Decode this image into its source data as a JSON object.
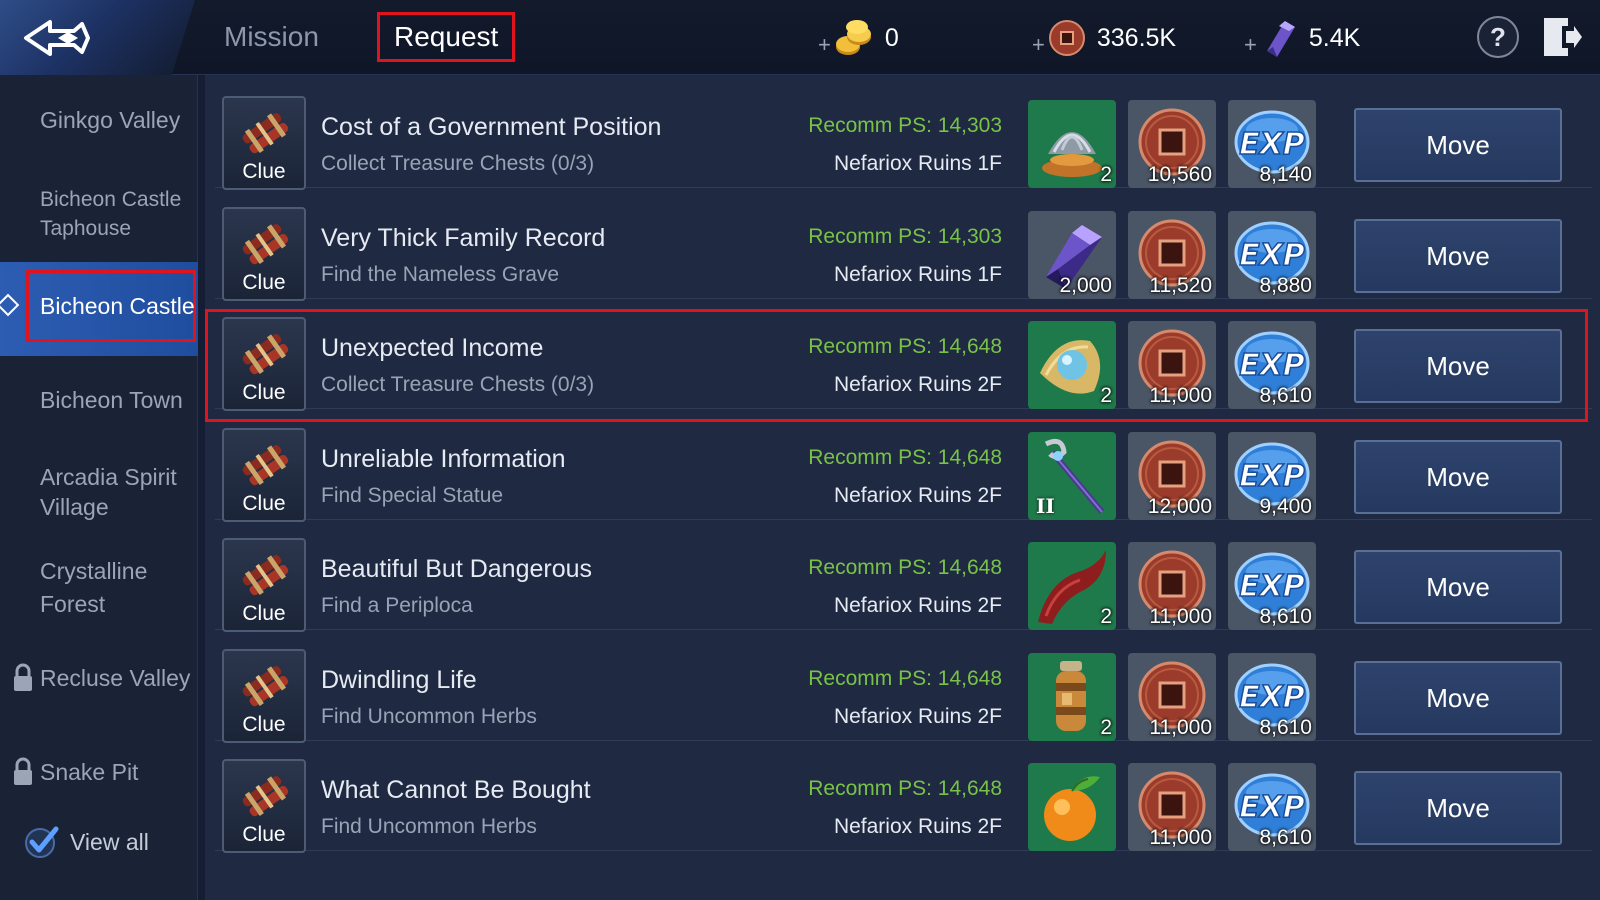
{
  "header": {
    "tabs": [
      {
        "label": "Mission",
        "active": false
      },
      {
        "label": "Request",
        "active": true
      }
    ],
    "currencies": [
      {
        "icon": "gold-coins-icon",
        "value": "0"
      },
      {
        "icon": "bronze-coin-icon",
        "value": "336.5K"
      },
      {
        "icon": "crystal-gem-icon",
        "value": "5.4K"
      }
    ],
    "help_label": "?"
  },
  "sidebar": {
    "items": [
      {
        "label": "Ginkgo Valley",
        "locked": false,
        "active": false
      },
      {
        "label": "Bicheon Castle Taphouse",
        "locked": false,
        "active": false
      },
      {
        "label": "Bicheon Castle",
        "locked": false,
        "active": true
      },
      {
        "label": "Bicheon Town",
        "locked": false,
        "active": false
      },
      {
        "label": "Arcadia Spirit Village",
        "locked": false,
        "active": false
      },
      {
        "label": "Crystalline Forest",
        "locked": false,
        "active": false
      },
      {
        "label": "Recluse Valley",
        "locked": true,
        "active": false
      },
      {
        "label": "Snake Pit",
        "locked": true,
        "active": false
      }
    ],
    "view_all": {
      "label": "View all",
      "checked": true
    }
  },
  "requests": [
    {
      "tag": "Clue",
      "title": "Cost of a Government Position",
      "objective": "Collect Treasure Chests (0/3)",
      "recomm_ps": "Recomm PS: 14,303",
      "location": "Nefariox Ruins 1F",
      "item": {
        "icon": "silver-ingot-icon",
        "count": "2"
      },
      "coins": "10,560",
      "exp": "8,140",
      "move_label": "Move"
    },
    {
      "tag": "Clue",
      "title": "Very Thick Family Record",
      "objective": "Find the Nameless Grave",
      "recomm_ps": "Recomm PS: 14,303",
      "location": "Nefariox Ruins 1F",
      "item": {
        "icon": "crystal-gem-icon",
        "count": "2,000"
      },
      "coins": "11,520",
      "exp": "8,880",
      "move_label": "Move"
    },
    {
      "tag": "Clue",
      "title": "Unexpected Income",
      "objective": "Collect Treasure Chests (0/3)",
      "recomm_ps": "Recomm PS: 14,648",
      "location": "Nefariox Ruins 2F",
      "item": {
        "icon": "pearl-orb-icon",
        "count": "2"
      },
      "coins": "11,000",
      "exp": "8,610",
      "move_label": "Move"
    },
    {
      "tag": "Clue",
      "title": "Unreliable Information",
      "objective": "Find Special Statue",
      "recomm_ps": "Recomm PS: 14,648",
      "location": "Nefariox Ruins 2F",
      "item": {
        "icon": "staff-weapon-icon",
        "count": "",
        "tier": "II"
      },
      "coins": "12,000",
      "exp": "9,400",
      "move_label": "Move"
    },
    {
      "tag": "Clue",
      "title": "Beautiful But Dangerous",
      "objective": "Find a Periploca",
      "recomm_ps": "Recomm PS: 14,648",
      "location": "Nefariox Ruins 2F",
      "item": {
        "icon": "red-horn-icon",
        "count": "2"
      },
      "coins": "11,000",
      "exp": "8,610",
      "move_label": "Move"
    },
    {
      "tag": "Clue",
      "title": "Dwindling Life",
      "objective": "Find Uncommon Herbs",
      "recomm_ps": "Recomm PS: 14,648",
      "location": "Nefariox Ruins 2F",
      "item": {
        "icon": "herb-jar-icon",
        "count": "2"
      },
      "coins": "11,000",
      "exp": "8,610",
      "move_label": "Move"
    },
    {
      "tag": "Clue",
      "title": "What Cannot Be Bought",
      "objective": "Find Uncommon Herbs",
      "recomm_ps": "Recomm PS: 14,648",
      "location": "Nefariox Ruins 2F",
      "item": {
        "icon": "orange-fruit-icon",
        "count": ""
      },
      "coins": "11,000",
      "exp": "8,610",
      "move_label": "Move"
    }
  ],
  "colors": {
    "highlight": "#e1141e",
    "recomm_green": "#78c248",
    "active_tab_blue": "#2d5db3"
  }
}
